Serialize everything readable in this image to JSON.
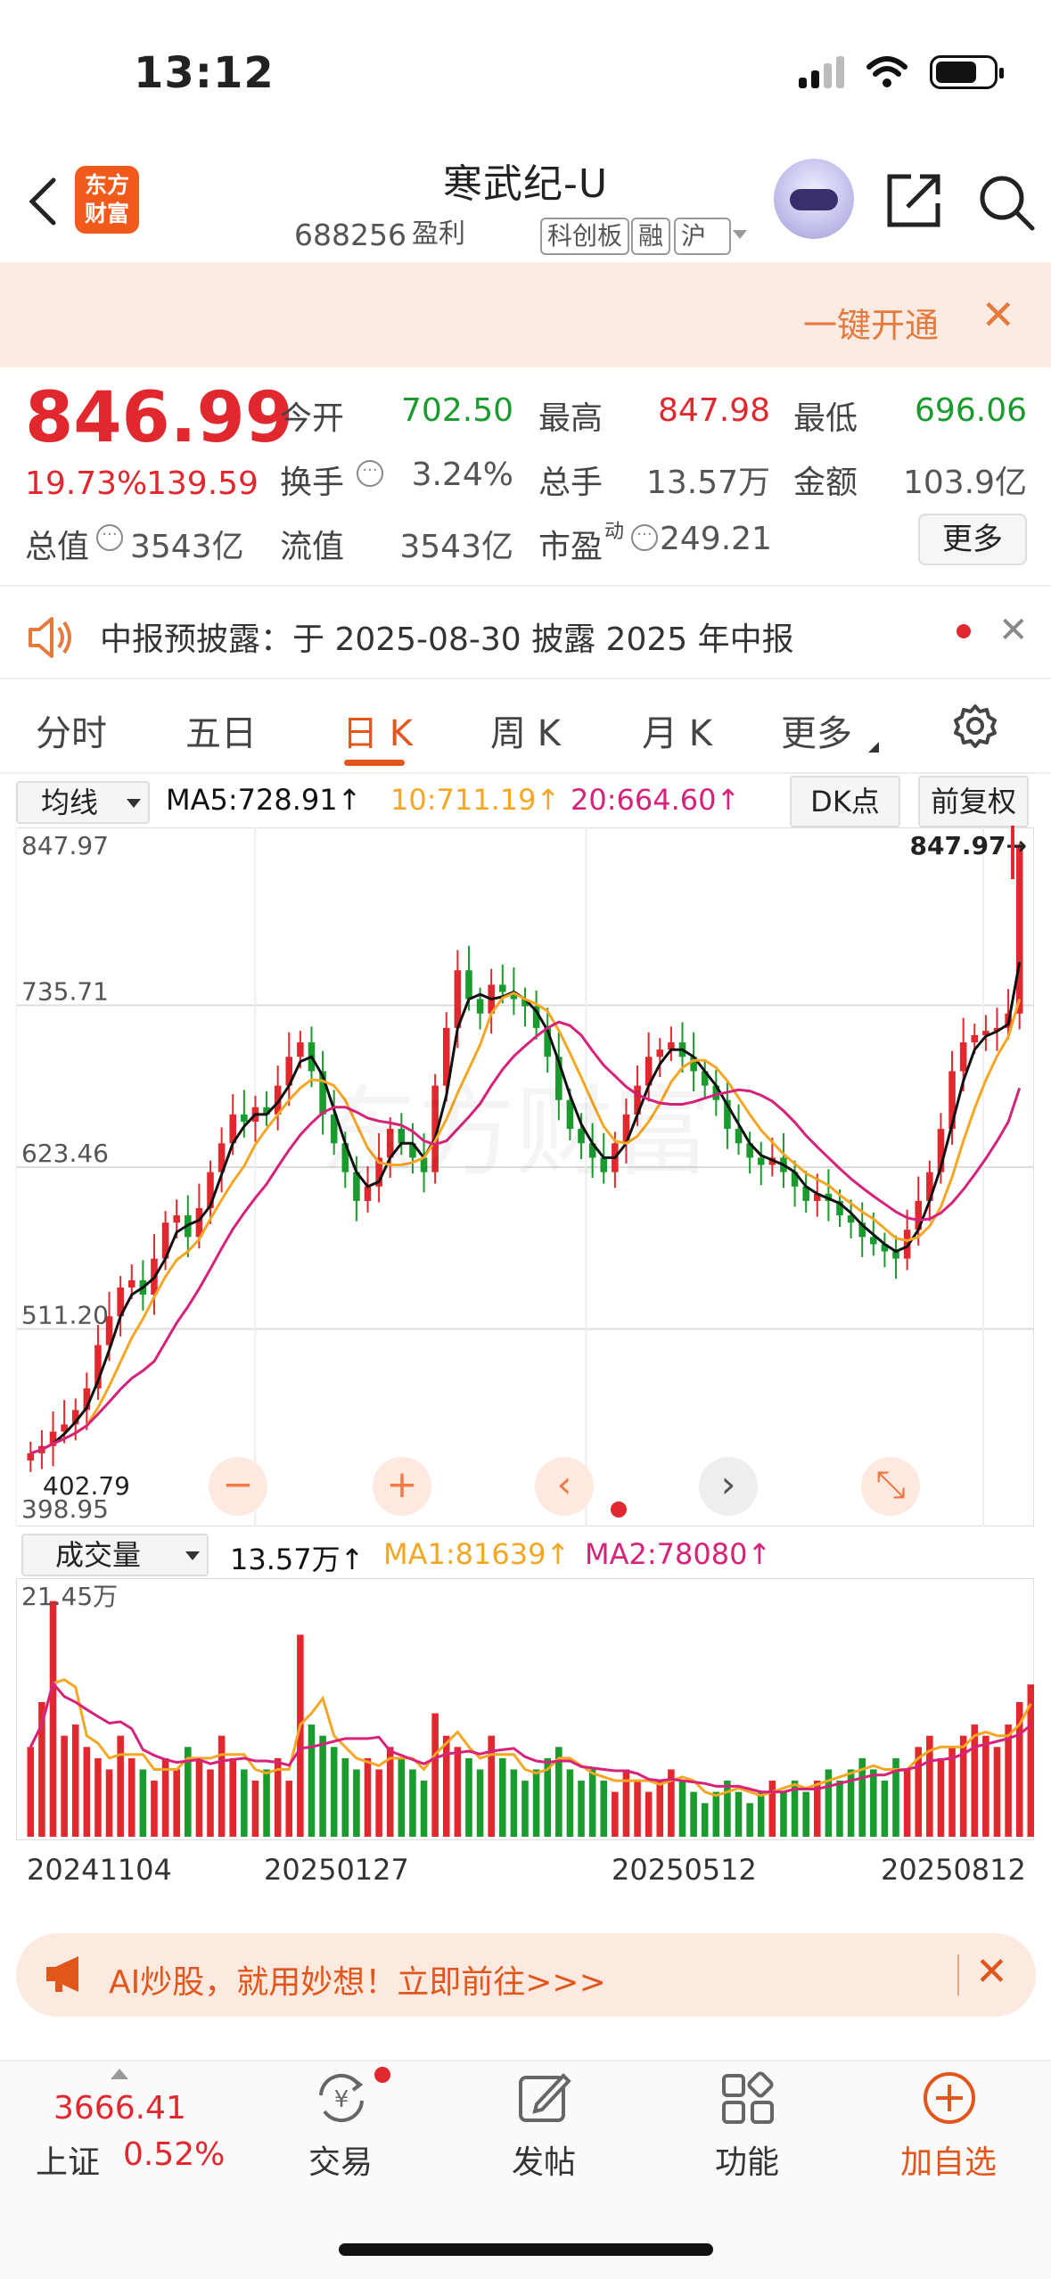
{
  "status": {
    "time": "13:12"
  },
  "header": {
    "logo": "东方\n财富",
    "name": "寒武纪-U",
    "code": "688256",
    "tags": [
      "盈利",
      "科创板",
      "融",
      "沪股"
    ]
  },
  "banner": {
    "text": "一键开通",
    "close": "✕"
  },
  "quote": {
    "price": "846.99",
    "change_pct": "19.73%",
    "change_amt": "139.59",
    "fields": [
      {
        "label": "今开",
        "value": "702.50",
        "color": "green"
      },
      {
        "label": "最高",
        "value": "847.98",
        "color": "red"
      },
      {
        "label": "最低",
        "value": "696.06",
        "color": "green"
      },
      {
        "label": "换手",
        "value": "3.24%",
        "color": "gray"
      },
      {
        "label": "总手",
        "value": "13.57万",
        "color": "gray"
      },
      {
        "label": "金额",
        "value": "103.9亿",
        "color": "gray"
      },
      {
        "label": "总值",
        "value": "3543亿",
        "color": "gray"
      },
      {
        "label": "流值",
        "value": "3543亿",
        "color": "gray"
      },
      {
        "label": "市盈",
        "value": "249.21",
        "color": "gray"
      }
    ],
    "pe_superscript": "动",
    "more": "更多"
  },
  "notice": {
    "text": "中报预披露：于 2025-08-30 披露 2025 年中报",
    "close": "✕"
  },
  "tabs": [
    "分时",
    "五日",
    "日 K",
    "周 K",
    "月 K",
    "更多"
  ],
  "chart_controls": {
    "indicator": "均线",
    "ma5": "MA5:728.91",
    "ma10": "10:711.19",
    "ma20": "20:664.60",
    "arrow": "↑",
    "dk": "DK点",
    "adjust": "前复权"
  },
  "chart_buttons": [
    "−",
    "+",
    "‹",
    "›",
    "⤡"
  ],
  "volume_controls": {
    "indicator": "成交量",
    "vol": "13.57万",
    "ma1": "MA1:81639",
    "ma2": "MA2:78080",
    "arrow": "↑"
  },
  "colors": {
    "up": "#e0282e",
    "down": "#1a9b2e",
    "ma5": "#111111",
    "ma10": "#f5a623",
    "ma20": "#d6227a",
    "accent": "#e2561c"
  },
  "chart_data": {
    "type": "candlestick",
    "y_ticks": [
      "847.97",
      "735.71",
      "623.46",
      "511.20",
      "398.95"
    ],
    "ylim": [
      398.95,
      847.97
    ],
    "max_label": "847.97→",
    "min_label": "402.79",
    "x_labels": [
      "20241104",
      "20250127",
      "20250512",
      "20250812"
    ],
    "close_series": [
      425,
      430,
      440,
      445,
      455,
      470,
      500,
      520,
      540,
      545,
      535,
      560,
      585,
      590,
      575,
      595,
      620,
      640,
      660,
      655,
      665,
      660,
      680,
      700,
      710,
      690,
      660,
      640,
      620,
      600,
      610,
      630,
      650,
      640,
      630,
      620,
      680,
      720,
      760,
      740,
      730,
      750,
      745,
      740,
      735,
      720,
      700,
      670,
      650,
      640,
      630,
      620,
      640,
      660,
      680,
      700,
      705,
      710,
      700,
      690,
      680,
      670,
      650,
      640,
      630,
      625,
      630,
      620,
      610,
      600,
      605,
      600,
      590,
      585,
      575,
      570,
      565,
      560,
      580,
      600,
      620,
      650,
      690,
      710,
      715,
      718,
      720,
      730,
      846.99
    ],
    "volume_label_max": "21.45万",
    "volume_series": [
      8,
      12,
      21,
      9,
      10,
      8,
      7,
      6,
      9,
      7,
      6,
      5,
      7,
      6,
      8,
      7,
      6,
      9,
      7,
      6,
      5,
      6,
      7,
      5,
      18,
      10,
      9,
      8,
      7,
      6,
      7,
      6,
      8,
      7,
      6,
      5,
      11,
      9,
      8,
      7,
      6,
      9,
      7,
      6,
      5,
      6,
      7,
      8,
      6,
      5,
      6,
      5,
      4,
      6,
      5,
      4,
      5,
      6,
      5,
      4,
      3,
      4,
      5,
      4,
      3,
      4,
      5,
      4,
      5,
      4,
      5,
      6,
      5,
      6,
      7,
      6,
      5,
      7,
      6,
      8,
      9,
      7,
      8,
      9,
      10,
      9,
      8,
      10,
      12,
      13.57
    ]
  },
  "ai_banner": {
    "text": "AI炒股，就用妙想！立即前往>>>",
    "close": "✕"
  },
  "bottom_nav": {
    "index_value": "3666.41",
    "index_name": "上证",
    "index_change": "0.52%",
    "items": [
      "交易",
      "发帖",
      "功能",
      "加自选"
    ]
  }
}
